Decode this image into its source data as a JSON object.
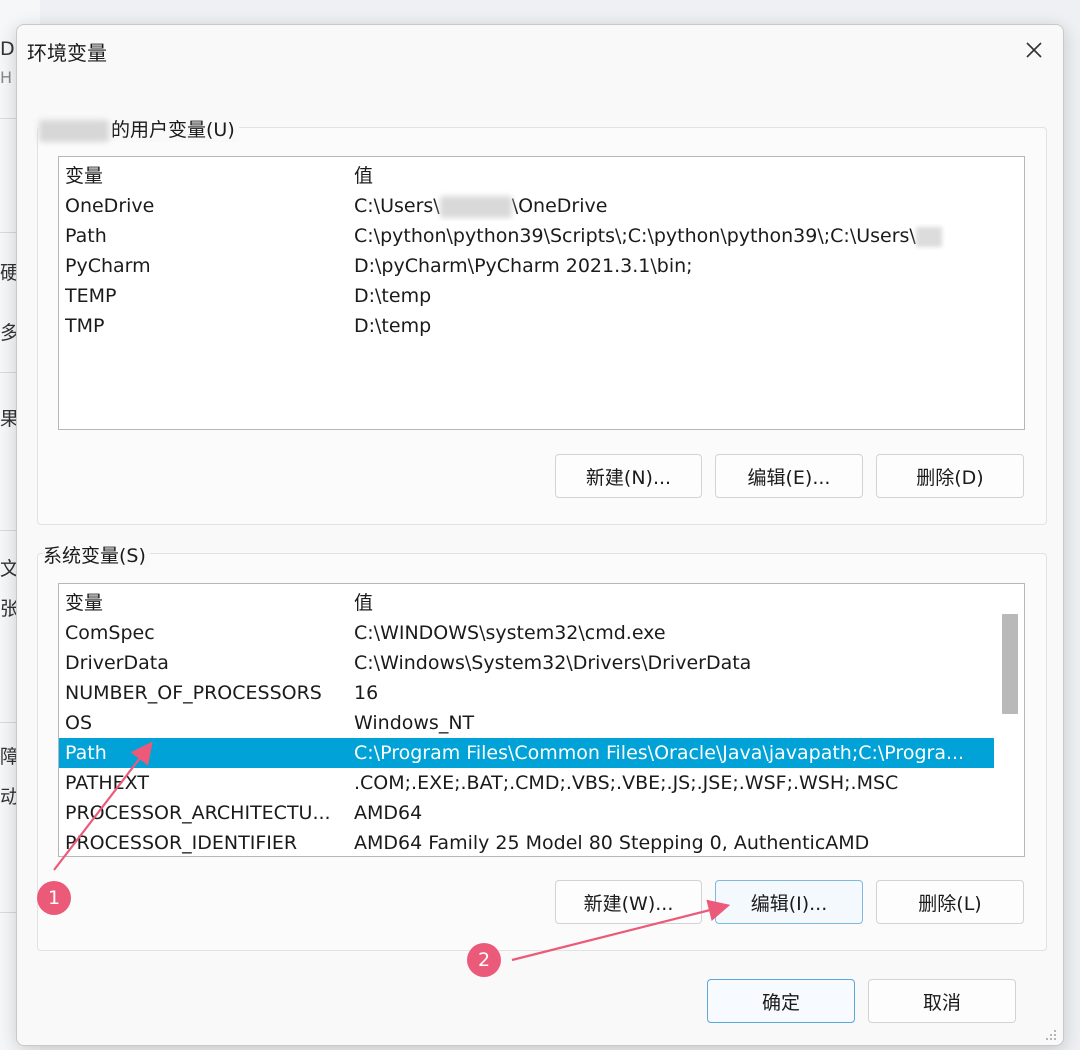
{
  "dialog": {
    "title": "环境变量"
  },
  "user_section": {
    "title": "的用户变量(U)",
    "headers": [
      "变量",
      "值"
    ],
    "rows": [
      [
        "OneDrive",
        "C:\\Users\\",
        "\\OneDrive"
      ],
      [
        "Path",
        "C:\\python\\python39\\Scripts\\;C:\\python\\python39\\;C:\\Users\\"
      ],
      [
        "PyCharm",
        "D:\\pyCharm\\PyCharm 2021.3.1\\bin;"
      ],
      [
        "TEMP",
        "D:\\temp"
      ],
      [
        "TMP",
        "D:\\temp"
      ]
    ],
    "buttons": {
      "new": "新建(N)...",
      "edit": "编辑(E)...",
      "delete": "删除(D)"
    }
  },
  "system_section": {
    "title": "系统变量(S)",
    "headers": [
      "变量",
      "值"
    ],
    "rows": [
      [
        "ComSpec",
        "C:\\WINDOWS\\system32\\cmd.exe"
      ],
      [
        "DriverData",
        "C:\\Windows\\System32\\Drivers\\DriverData"
      ],
      [
        "NUMBER_OF_PROCESSORS",
        "16"
      ],
      [
        "OS",
        "Windows_NT"
      ],
      [
        "Path",
        "C:\\Program Files\\Common Files\\Oracle\\Java\\javapath;C:\\Progra..."
      ],
      [
        "PATHEXT",
        ".COM;.EXE;.BAT;.CMD;.VBS;.VBE;.JS;.JSE;.WSF;.WSH;.MSC"
      ],
      [
        "PROCESSOR_ARCHITECTU...",
        "AMD64"
      ],
      [
        "PROCESSOR_IDENTIFIER",
        "AMD64 Family 25 Model 80 Stepping 0, AuthenticAMD"
      ]
    ],
    "selected_row": 4,
    "buttons": {
      "new": "新建(W)...",
      "edit": "编辑(I)...",
      "delete": "删除(L)"
    }
  },
  "footer": {
    "ok": "确定",
    "cancel": "取消"
  },
  "annotations": {
    "badge1": "1",
    "badge2": "2",
    "color": "#ec5a7a"
  },
  "background_window": {
    "chars": [
      "D",
      "H",
      "硬",
      "多",
      "果,",
      "文",
      "张",
      "障",
      "动,"
    ]
  },
  "icons": {
    "close": "close-icon",
    "grip": "resize-grip-icon"
  }
}
